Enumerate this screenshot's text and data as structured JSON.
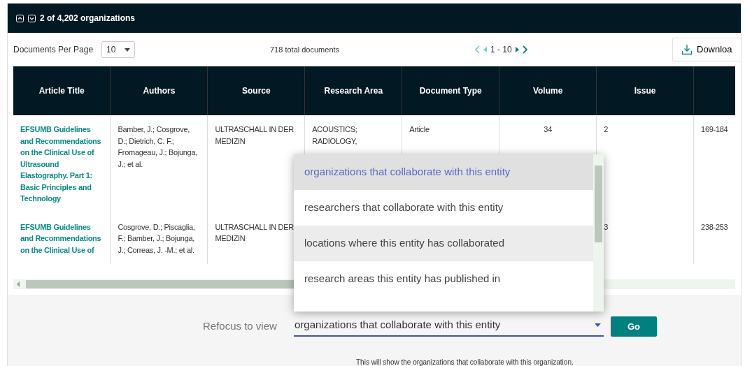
{
  "header": {
    "count_label": "2 of 4,202 organizations"
  },
  "toolbar": {
    "per_page_label": "Documents Per Page",
    "per_page_value": "10",
    "total": "718 total documents",
    "range": "1 - 10",
    "download": "Downloa"
  },
  "table": {
    "columns": [
      "Article Title",
      "Authors",
      "Source",
      "Research Area",
      "Document Type",
      "Volume",
      "Issue",
      ""
    ],
    "rows": [
      {
        "cells": [
          "EFSUMB Guidelines and Recommendations on the Clinical Use of Ultrasound Elastography. Part 1: Basic Principles and Technology",
          "Bamber, J.; Cosgrove, D.; Dietrich, C. F.; Fromageau, J.; Bojunga, J.; et al.",
          "ULTRASCHALL IN DER MEDIZIN",
          "ACOUSTICS; RADIOLOGY,",
          "Article",
          "34",
          "2",
          "169-184"
        ]
      },
      {
        "cells": [
          "EFSUMB Guidelines and Recommendations on the Clinical Use of",
          "Cosgrove, D.; Piscaglia, F.; Bamber, J.; Bojunga, J.; Correas, J. -M.; et al.",
          "ULTRASCHALL IN DER MEDIZIN",
          "",
          "",
          "",
          "3",
          "238-253"
        ]
      }
    ]
  },
  "dropdown": {
    "options": [
      {
        "label": "organizations that collaborate with this entity",
        "selected": true,
        "hovered": false
      },
      {
        "label": "researchers that collaborate with this entity",
        "selected": false,
        "hovered": false
      },
      {
        "label": "locations where this entity has collaborated",
        "selected": false,
        "hovered": true
      },
      {
        "label": "research areas this entity has published in",
        "selected": false,
        "hovered": false
      }
    ]
  },
  "refocus": {
    "label": "Refocus to view",
    "value": "organizations that collaborate with this entity",
    "button": "Go",
    "note": "This will show the organizations that collaborate with this organization."
  }
}
